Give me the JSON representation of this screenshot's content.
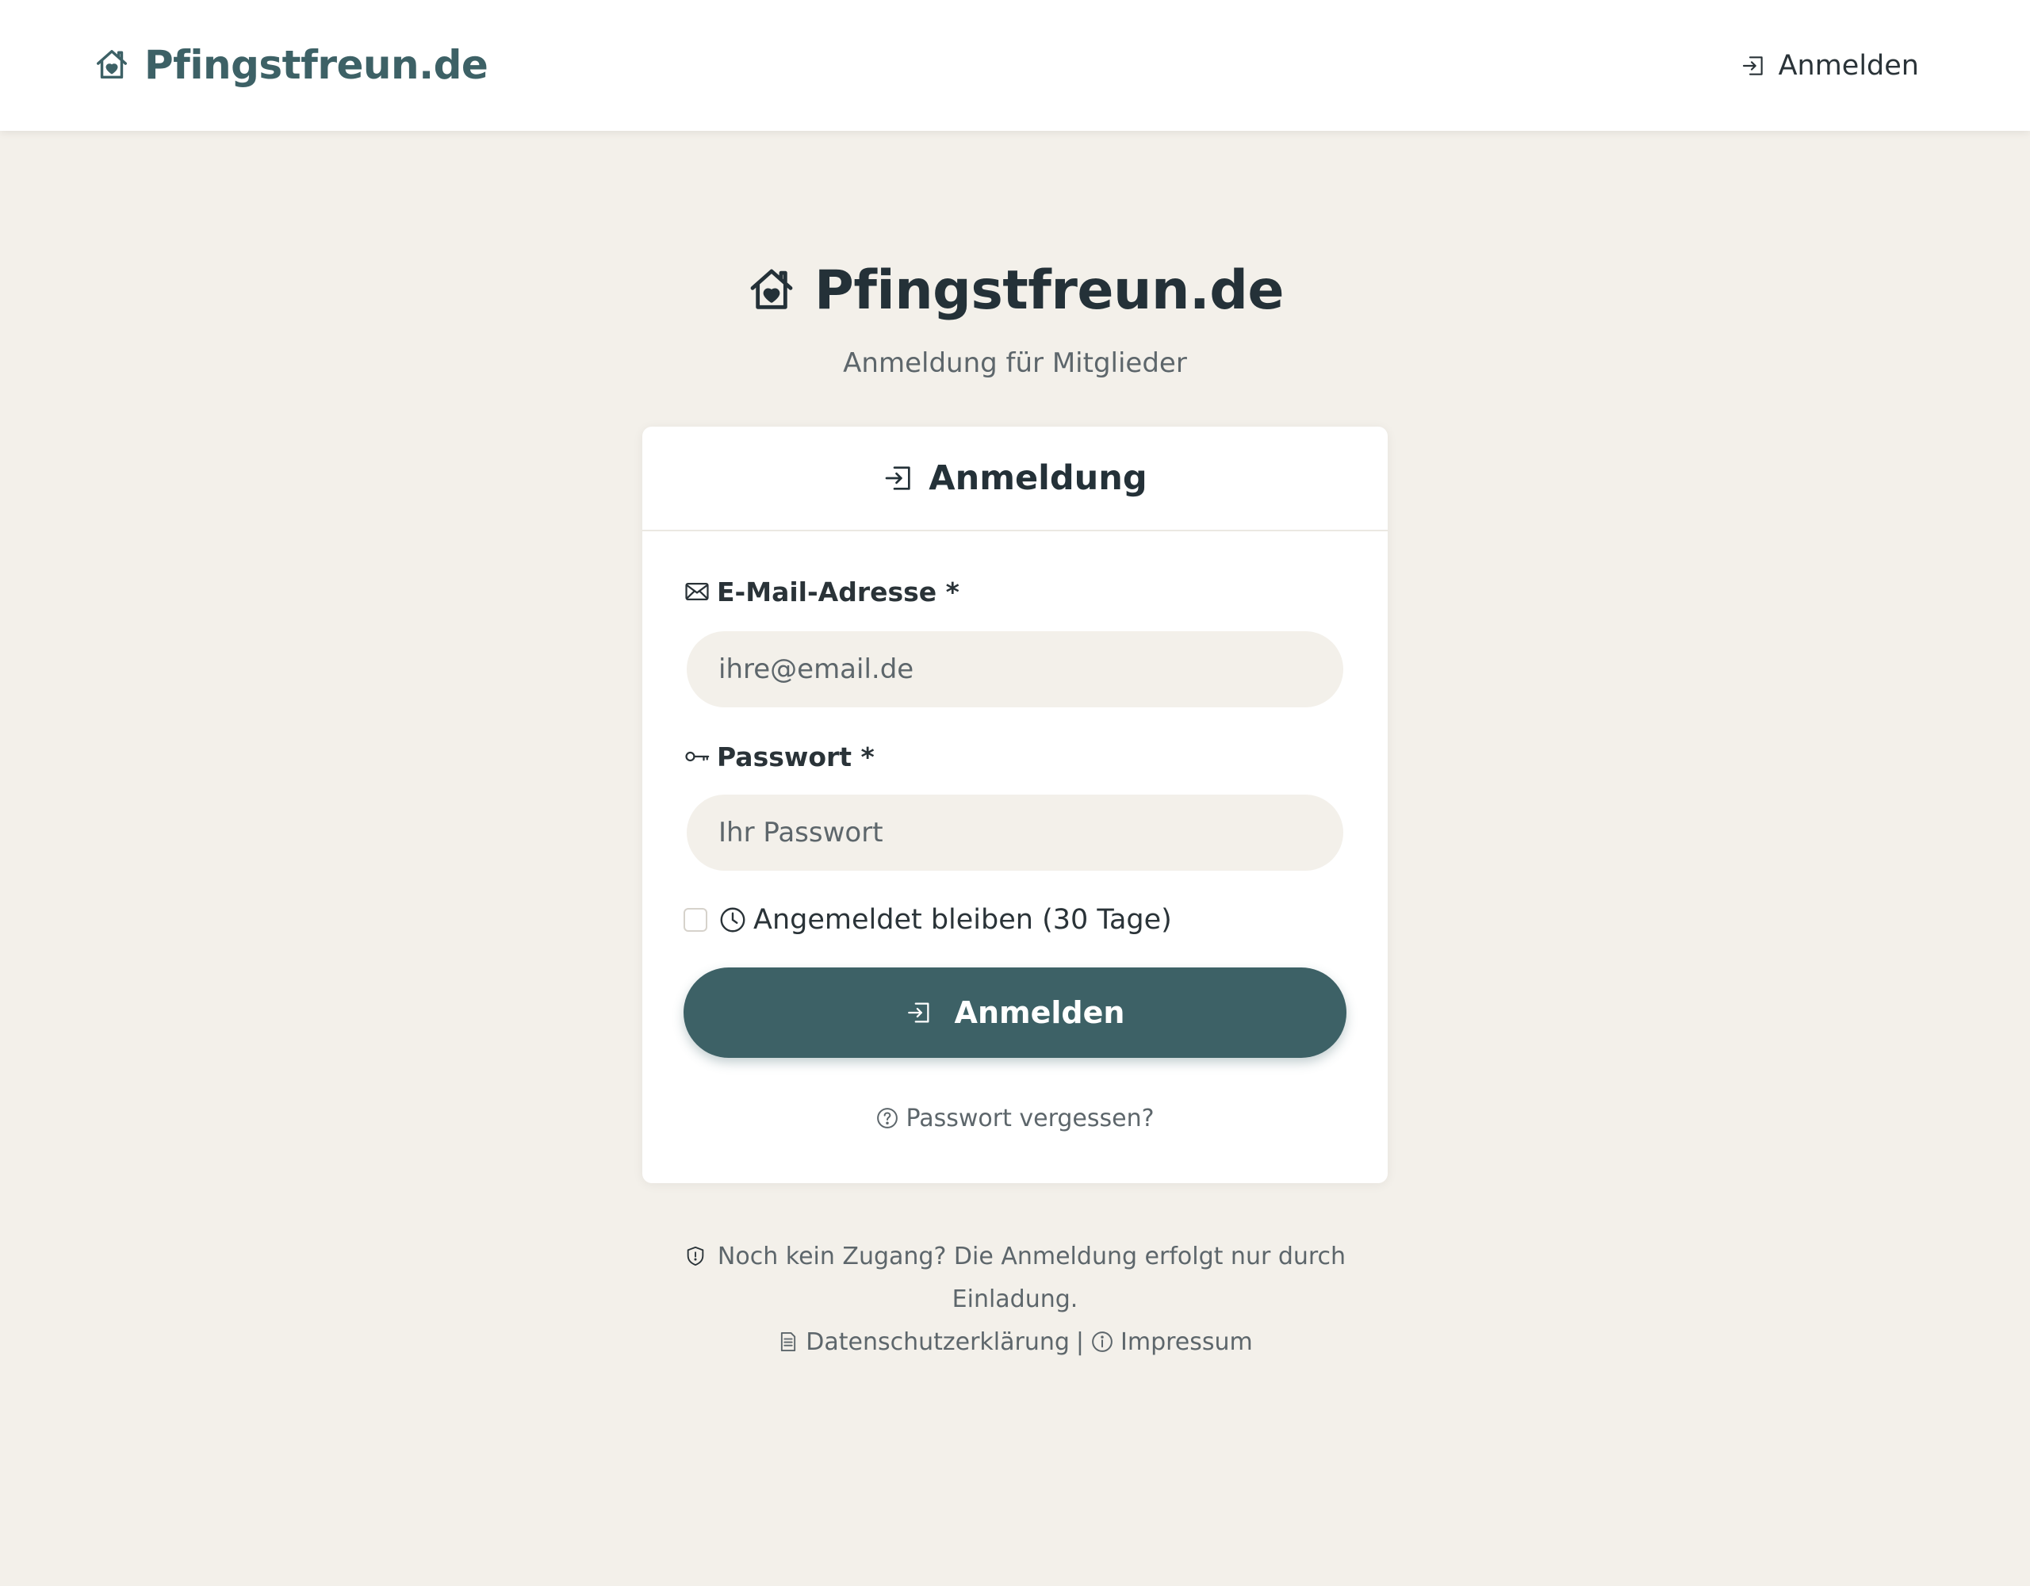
{
  "navbar": {
    "brand": "Pfingstfreun.de",
    "brand_icon": "house-heart-icon",
    "login_label": "Anmelden",
    "login_icon": "login-icon"
  },
  "hero": {
    "title": "Pfingstfreun.de",
    "subtitle": "Anmeldung für Mitglieder"
  },
  "card": {
    "title": "Anmeldung",
    "email": {
      "label": "E-Mail-Adresse *",
      "icon": "envelope-icon",
      "placeholder": "ihre@email.de",
      "value": ""
    },
    "password": {
      "label": "Passwort *",
      "icon": "key-icon",
      "placeholder": "Ihr Passwort",
      "value": ""
    },
    "remember": {
      "label": "Angemeldet bleiben (30 Tage)",
      "icon": "clock-icon",
      "checked": false
    },
    "submit_label": "Anmelden",
    "forgot_label": "Passwort vergessen?"
  },
  "footer": {
    "note": "Noch kein Zugang? Die Anmeldung erfolgt nur durch Einladung.",
    "privacy_label": "Datenschutzerklärung",
    "separator": "|",
    "imprint_label": "Impressum"
  },
  "colors": {
    "brand": "#3d6166",
    "background": "#f3f0ea",
    "card": "#ffffff",
    "text": "#2a3338",
    "muted": "#5d666b"
  }
}
